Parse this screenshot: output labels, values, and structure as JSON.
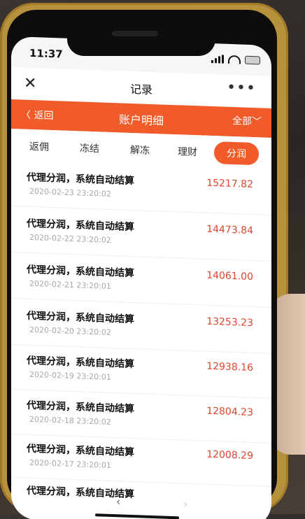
{
  "status": {
    "time": "11:37"
  },
  "header": {
    "title": "记录",
    "close": "✕",
    "more": "•••"
  },
  "subheader": {
    "back": "〈 返回",
    "title": "账户明细",
    "filter": "全部﹀"
  },
  "tabs": [
    "返佣",
    "冻结",
    "解冻",
    "理财",
    "分润"
  ],
  "active_tab": "分润",
  "records": [
    {
      "title": "代理分润，系统自动结算",
      "date": "2020-02-23 23:20:02",
      "amount": "15217.82"
    },
    {
      "title": "代理分润，系统自动结算",
      "date": "2020-02-22 23:20:02",
      "amount": "14473.84"
    },
    {
      "title": "代理分润，系统自动结算",
      "date": "2020-02-21 23:20:01",
      "amount": "14061.00"
    },
    {
      "title": "代理分润，系统自动结算",
      "date": "2020-02-20 23:20:02",
      "amount": "13253.23"
    },
    {
      "title": "代理分润，系统自动结算",
      "date": "2020-02-19 23:20:01",
      "amount": "12938.16"
    },
    {
      "title": "代理分润，系统自动结算",
      "date": "2020-02-18 23:20:02",
      "amount": "12804.23"
    },
    {
      "title": "代理分润，系统自动结算",
      "date": "2020-02-17 23:20:01",
      "amount": "12008.29"
    },
    {
      "title": "代理分润，系统自动结算",
      "date": "",
      "amount": ""
    }
  ],
  "bottom_nav": {
    "back": "‹",
    "forward": "›"
  }
}
